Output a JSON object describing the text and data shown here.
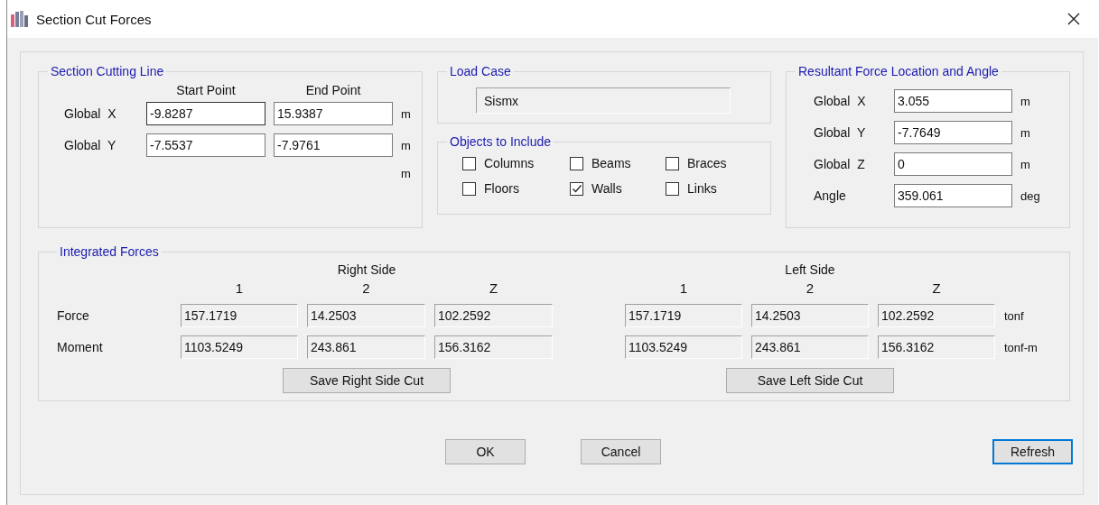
{
  "window": {
    "title": "Section Cut Forces"
  },
  "section_cutting_line": {
    "title": "Section Cutting Line",
    "columns": [
      "Start Point",
      "End Point"
    ],
    "rows": [
      {
        "label": "Global  X",
        "start": "-9.8287",
        "end": "15.9387",
        "unit": "m"
      },
      {
        "label": "Global  Y",
        "start": "-7.5537",
        "end": "-7.9761",
        "unit": "m"
      }
    ],
    "extra_unit": "m"
  },
  "load_case": {
    "title": "Load Case",
    "value": "Sismx"
  },
  "objects_to_include": {
    "title": "Objects to Include",
    "items": [
      {
        "label": "Columns",
        "checked": false
      },
      {
        "label": "Beams",
        "checked": false
      },
      {
        "label": "Braces",
        "checked": false
      },
      {
        "label": "Floors",
        "checked": false
      },
      {
        "label": "Walls",
        "checked": true
      },
      {
        "label": "Links",
        "checked": false
      }
    ]
  },
  "resultant": {
    "title": "Resultant Force Location and Angle",
    "rows": [
      {
        "label": "Global  X",
        "value": "3.055",
        "unit": "m"
      },
      {
        "label": "Global  Y",
        "value": "-7.7649",
        "unit": "m"
      },
      {
        "label": "Global  Z",
        "value": "0",
        "unit": "m"
      },
      {
        "label": "Angle",
        "value": "359.061",
        "unit": "deg"
      }
    ]
  },
  "integrated_forces": {
    "title": "Integrated Forces",
    "row_labels": [
      "Force",
      "Moment"
    ],
    "units": [
      "tonf",
      "tonf-m"
    ],
    "sides": [
      {
        "title": "Right Side",
        "columns": [
          "1",
          "2",
          "Z"
        ],
        "rows": [
          [
            "157.1719",
            "14.2503",
            "102.2592"
          ],
          [
            "1103.5249",
            "243.861",
            "156.3162"
          ]
        ],
        "button": "Save Right Side Cut"
      },
      {
        "title": "Left Side",
        "columns": [
          "1",
          "2",
          "Z"
        ],
        "rows": [
          [
            "157.1719",
            "14.2503",
            "102.2592"
          ],
          [
            "1103.5249",
            "243.861",
            "156.3162"
          ]
        ],
        "button": "Save Left Side Cut"
      }
    ]
  },
  "buttons": [
    {
      "label": "OK",
      "focused": false
    },
    {
      "label": "Cancel",
      "focused": false
    },
    {
      "label": "Refresh",
      "focused": true
    }
  ]
}
